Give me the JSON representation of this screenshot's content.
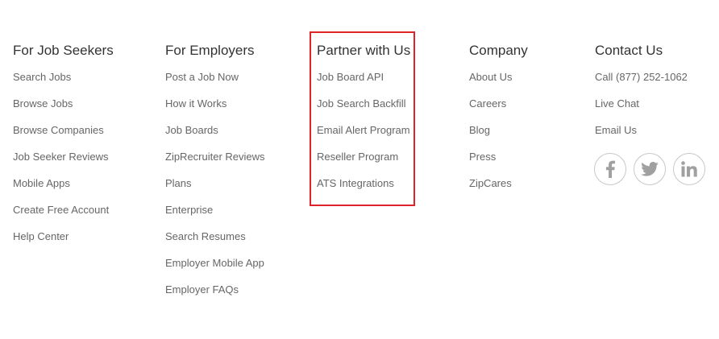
{
  "footer": {
    "columns": [
      {
        "heading": "For Job Seekers",
        "links": [
          "Search Jobs",
          "Browse Jobs",
          "Browse Companies",
          "Job Seeker Reviews",
          "Mobile Apps",
          "Create Free Account",
          "Help Center"
        ]
      },
      {
        "heading": "For Employers",
        "links": [
          "Post a Job Now",
          "How it Works",
          "Job Boards",
          "ZipRecruiter Reviews",
          "Plans",
          "Enterprise",
          "Search Resumes",
          "Employer Mobile App",
          "Employer FAQs"
        ]
      },
      {
        "heading": "Partner with Us",
        "links": [
          "Job Board API",
          "Job Search Backfill",
          "Email Alert Program",
          "Reseller Program",
          "ATS Integrations"
        ]
      },
      {
        "heading": "Company",
        "links": [
          "About Us",
          "Careers",
          "Blog",
          "Press",
          "ZipCares"
        ]
      },
      {
        "heading": "Contact Us",
        "links": [
          "Call (877) 252-1062",
          "Live Chat",
          "Email Us"
        ]
      }
    ],
    "social": [
      {
        "icon": "facebook-icon"
      },
      {
        "icon": "twitter-icon"
      },
      {
        "icon": "linkedin-icon"
      }
    ],
    "highlight_color": "#e0232b",
    "social_icon_color": "#a0a0a0"
  }
}
